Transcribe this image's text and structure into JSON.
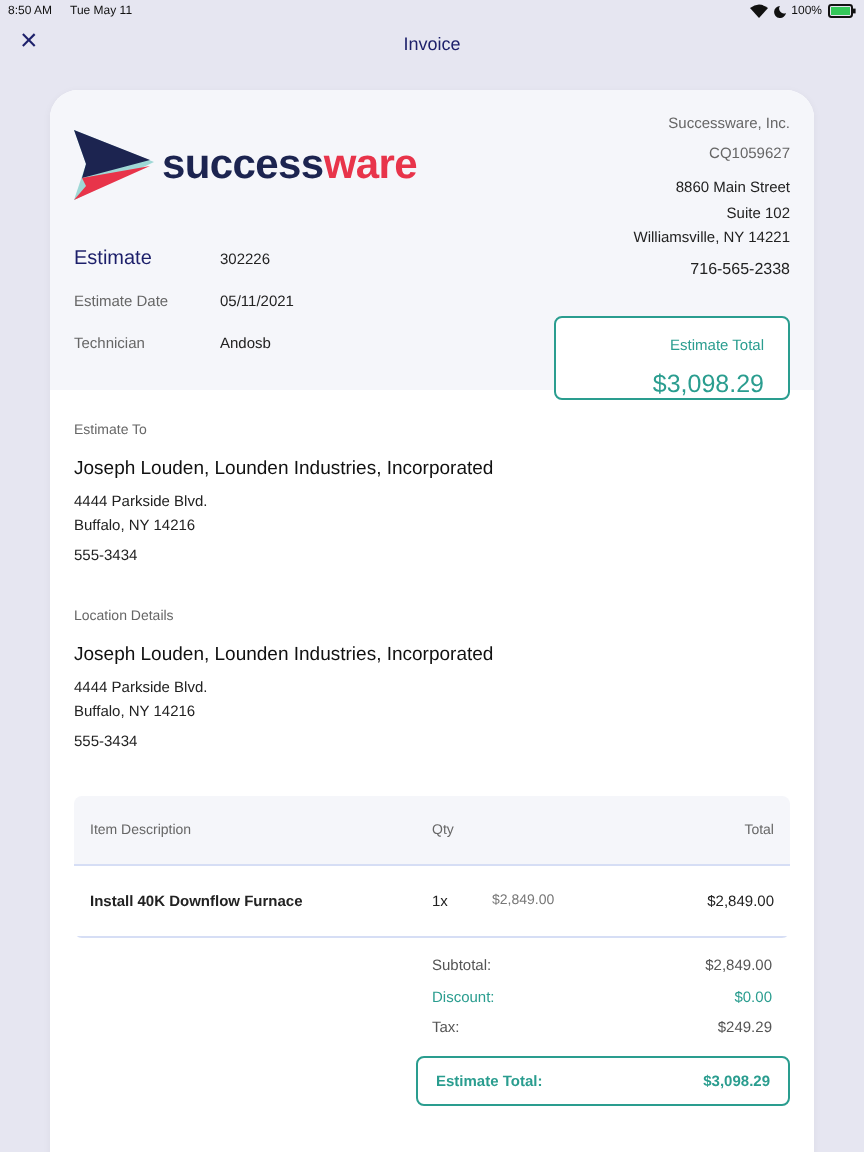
{
  "status_bar": {
    "time": "8:50 AM",
    "date": "Tue May 11",
    "battery": "100%"
  },
  "nav": {
    "close": "×",
    "title": "Invoice"
  },
  "logo": {
    "part1": "success",
    "part2": "ware"
  },
  "company": {
    "name": "Successware, Inc.",
    "code": "CQ1059627",
    "address": [
      "8860 Main Street",
      "Suite 102",
      "Williamsville, NY 14221"
    ],
    "phone": "716-565-2338"
  },
  "estimate": {
    "label": "Estimate",
    "number": "302226",
    "fields": [
      {
        "label": "Estimate Date",
        "value": "05/11/2021"
      },
      {
        "label": "Technician",
        "value": "Andosb"
      }
    ]
  },
  "total_box": {
    "label": "Estimate Total",
    "amount": "$3,098.29"
  },
  "sections": [
    {
      "heading": "Estimate To",
      "name": "Joseph Louden, Lounden Industries, Incorporated",
      "address": [
        "4444 Parkside Blvd.",
        "Buffalo, NY 14216"
      ],
      "phone": "555-3434"
    },
    {
      "heading": "Location Details",
      "name": "Joseph Louden, Lounden Industries, Incorporated",
      "address": [
        "4444 Parkside Blvd.",
        "Buffalo, NY 14216"
      ],
      "phone": "555-3434"
    }
  ],
  "table": {
    "columns": [
      "Item Description",
      "Qty",
      "Total"
    ],
    "rows": [
      {
        "description": "Install 40K Downflow Furnace",
        "qty": "1x",
        "unit_price": "$2,849.00",
        "total": "$2,849.00"
      }
    ]
  },
  "summary": [
    {
      "kind": "plain",
      "label": "Subtotal:",
      "value": "$2,849.00"
    },
    {
      "kind": "discount",
      "label": "Discount:",
      "value": "$0.00"
    },
    {
      "kind": "plain",
      "label": "Tax:",
      "value": "$249.29"
    }
  ],
  "grand_total": {
    "label": "Estimate Total:",
    "value": "$3,098.29"
  }
}
